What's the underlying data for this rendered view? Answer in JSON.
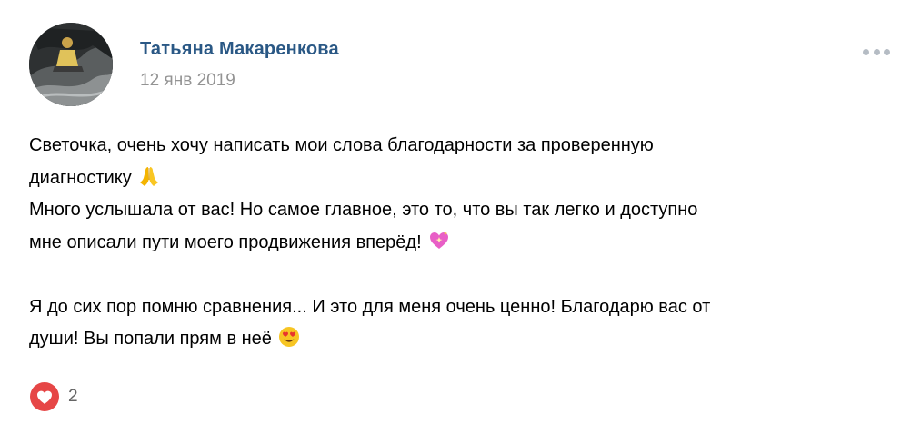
{
  "post": {
    "author": "Татьяна Макаренкова",
    "date": "12 янв 2019",
    "more_icon": "more-dots-icon",
    "lines": [
      "Светочка, очень хочу написать мои слова благодарности за проверенную",
      "диагностику",
      "Много услышала от вас! Но самое главное, это то, что вы так легко и доступно",
      "мне описали пути моего продвижения вперёд!",
      "",
      "Я до сих пор помню сравнения... И это для меня очень ценно! Благодарю вас от",
      "души! Вы попали прям в неё"
    ],
    "emojis": {
      "line2": "folded-hands-emoji",
      "line4": "sparkling-heart-emoji",
      "line7": "heart-eyes-emoji"
    },
    "likes": {
      "count": "2",
      "icon": "heart-icon",
      "color": "#e64646"
    }
  },
  "colors": {
    "author": "#2a5885",
    "date": "#939393",
    "text": "#000000",
    "more_dots": "#b5bcc4",
    "like_count": "#656565"
  }
}
